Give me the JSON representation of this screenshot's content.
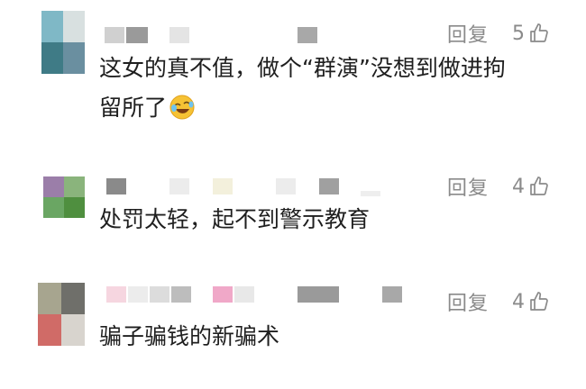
{
  "comments": [
    {
      "text_line1": "这女的真不值，做个“群演”没想到做进拘",
      "text_line2": "留所了",
      "reply_label": "回复",
      "like_count": "5",
      "emoji": "rolling-laughing-emoji",
      "avatar_colors": [
        "#7fb8c6",
        "#d8e0e0",
        "#3f7b86",
        "#6a8fa0"
      ]
    },
    {
      "text_line1": "处罚太轻，起不到警示教育",
      "reply_label": "回复",
      "like_count": "4",
      "avatar_colors": [
        "#9b7ea9",
        "#8ab47c",
        "#6aa663",
        "#4f8f3f"
      ]
    },
    {
      "text_line1": "骗子骗钱的新骗术",
      "reply_label": "回复",
      "like_count": "4",
      "avatar_colors": [
        "#a7a58f",
        "#6f6f6a",
        "#d06b67",
        "#d8d4ce"
      ]
    }
  ],
  "icons": {
    "like": "thumbs-up-icon"
  }
}
